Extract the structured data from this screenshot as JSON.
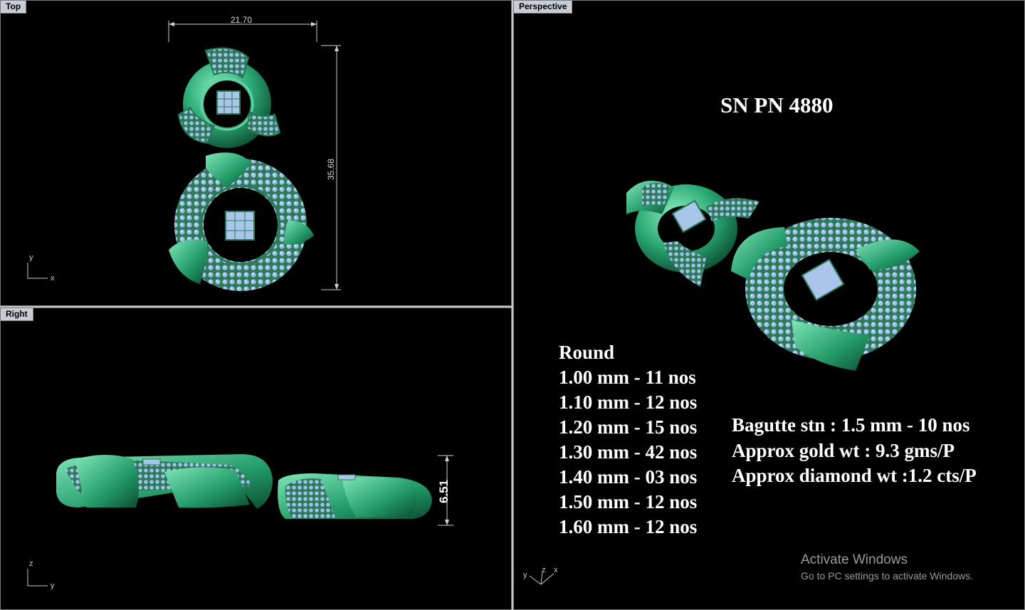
{
  "viewports": {
    "top": {
      "title": "Top",
      "dim_width": "21.70",
      "dim_height": "35.68",
      "axis_x": "x",
      "axis_y": "y"
    },
    "right": {
      "title": "Right",
      "dim_height": "6.51",
      "axis_x": "y",
      "axis_y": "z"
    },
    "perspective": {
      "title": "Perspective",
      "axis_x": "x",
      "axis_y": "y",
      "axis_z": "z"
    }
  },
  "annotation": {
    "product_code": "SN PN 4880",
    "round_heading": "Round",
    "round_sizes": [
      "1.00 mm - 11 nos",
      "1.10 mm - 12 nos",
      "1.20 mm - 15 nos",
      "1.30 mm - 42 nos",
      "1.40 mm - 03 nos",
      "1.50 mm - 12 nos",
      "1.60 mm - 12 nos"
    ],
    "specs": [
      "Bagutte stn : 1.5 mm - 10 nos",
      "Approx gold wt : 9.3 gms/P",
      "Approx diamond wt :1.2 cts/P"
    ]
  },
  "watermark": {
    "title": "Activate Windows",
    "subtitle": "Go to PC settings to activate Windows."
  },
  "colors": {
    "metal": "#1e8a5c",
    "metal_highlight": "#6fe0b0",
    "stone": "#a9c6ea",
    "background": "#000000"
  }
}
